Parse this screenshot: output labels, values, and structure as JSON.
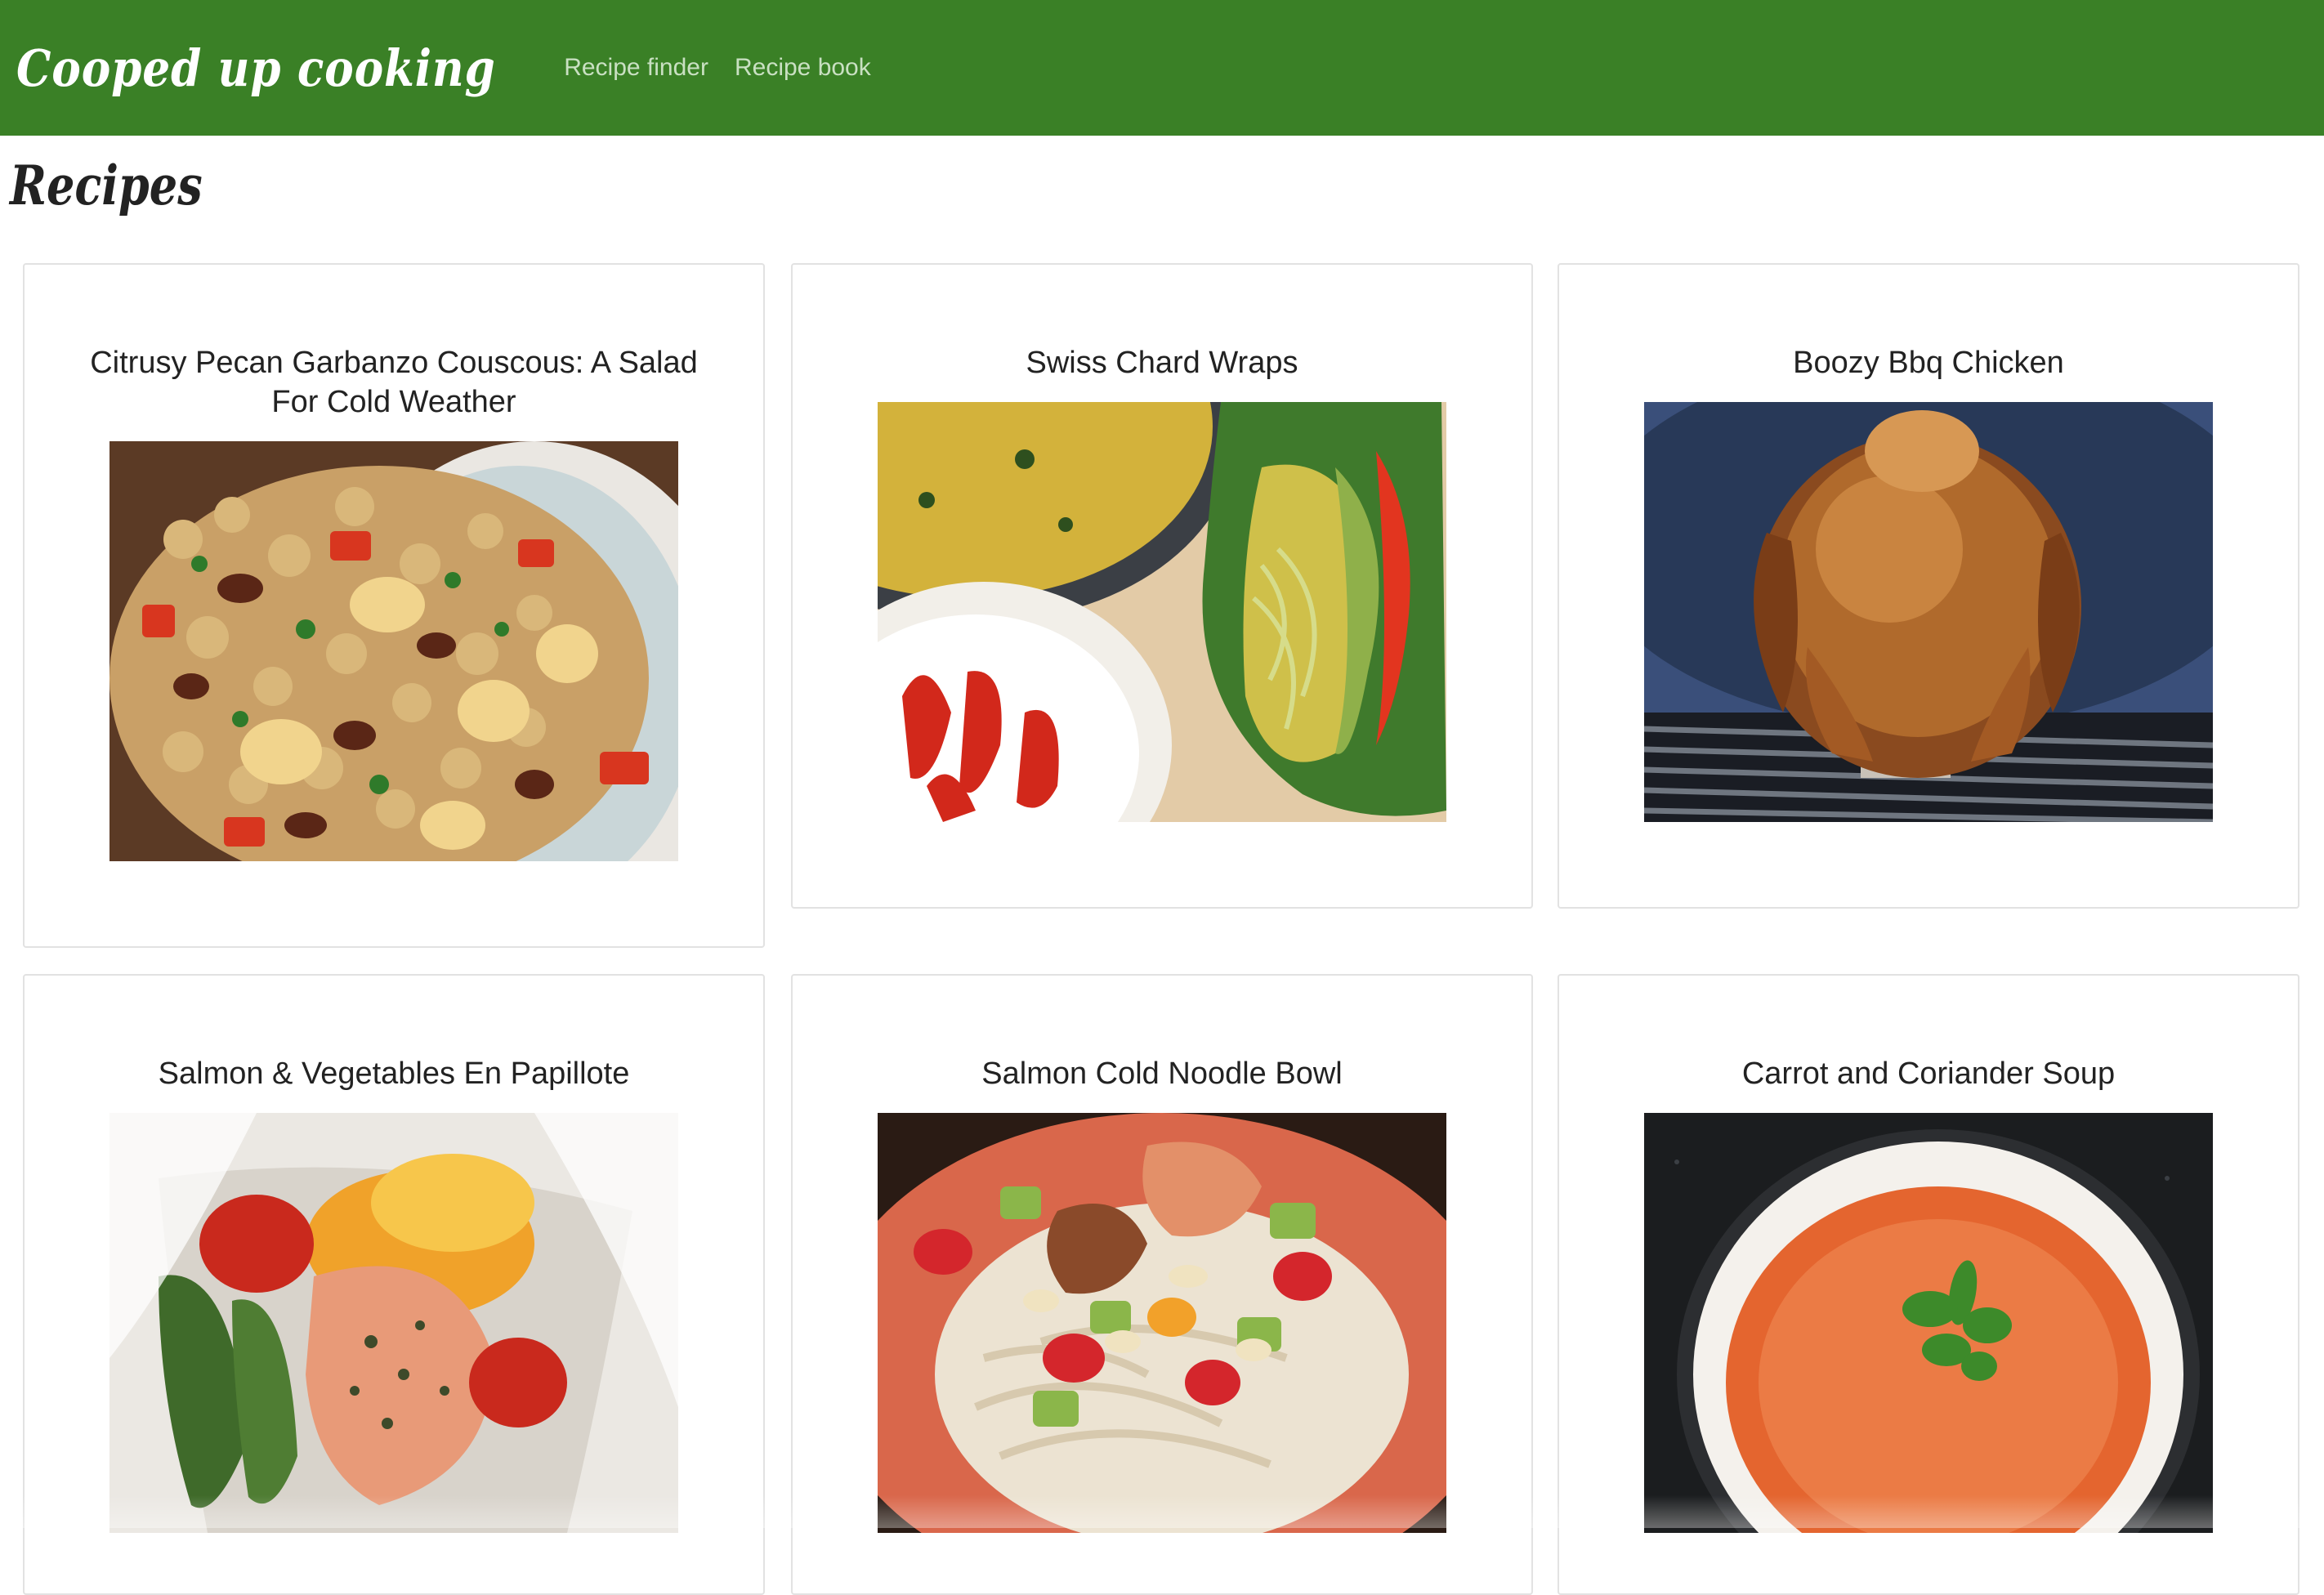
{
  "navbar": {
    "brand": "Cooped up cooking",
    "links": [
      "Recipe finder",
      "Recipe book"
    ],
    "color": "#3a8026"
  },
  "page": {
    "title": "Recipes"
  },
  "recipes": [
    {
      "title": "Citrusy Pecan Garbanzo Couscous: A Salad For Cold Weather",
      "image": "couscous-salad-photo"
    },
    {
      "title": "Swiss Chard Wraps",
      "image": "chard-wraps-photo"
    },
    {
      "title": "Boozy Bbq Chicken",
      "image": "beer-can-chicken-photo"
    },
    {
      "title": "Salmon & Vegetables En Papillote",
      "image": "salmon-papillote-photo"
    },
    {
      "title": "Salmon Cold Noodle Bowl",
      "image": "salmon-noodle-bowl-photo"
    },
    {
      "title": "Carrot and Coriander Soup",
      "image": "carrot-soup-photo"
    }
  ]
}
